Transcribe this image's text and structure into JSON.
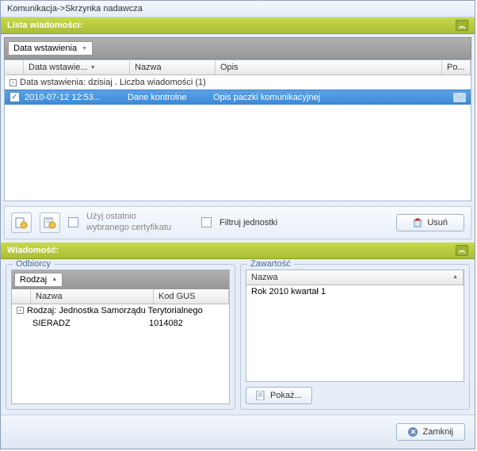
{
  "titlebar": "Komunikacja->Skrzynka nadawcza",
  "section1": {
    "title": "Lista wiadomości:"
  },
  "groupPill": "Data wstawienia",
  "columns": {
    "c1": "Data wstawie...",
    "c2": "Nazwa",
    "c3": "Opis",
    "c4": "Po..."
  },
  "groupRow": "Data wstawienia:  dzisiaj . Liczba wiadomości (1)",
  "row": {
    "date": "2010-07-12  12:53...",
    "name": "Dane kontrolne",
    "desc": "Opis paczki komunikacyjnej"
  },
  "toolbar": {
    "lastCert": "Użyj ostatnio\nwybranego certyfikatu",
    "filter": "Filtruj jednostki",
    "delete": "Usuń"
  },
  "section2": {
    "title": "Wiadomość:"
  },
  "odbiorcy": {
    "legend": "Odbiorcy",
    "pill": "Rodzaj",
    "cols": {
      "c1": "Nazwa",
      "c2": "Kod GUS"
    },
    "grp": "Rodzaj:  Jednostka Samorządu Terytorialnego",
    "r": {
      "name": "SIERADZ",
      "code": "1014082"
    }
  },
  "zawartosc": {
    "legend": "Zawartość",
    "col": "Nazwa",
    "r": "Rok 2010 kwartał 1",
    "show": "Pokaż..."
  },
  "footer": {
    "close": "Zamknij"
  }
}
